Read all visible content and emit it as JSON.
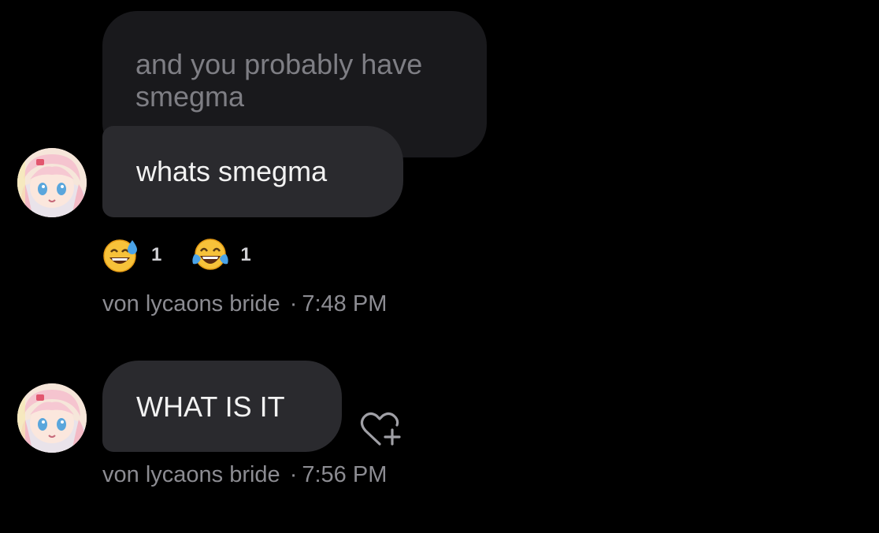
{
  "conversation": {
    "quoted_message": {
      "text": "and you probably have smegma"
    },
    "messages": [
      {
        "text": "whats smegma",
        "reactions": [
          {
            "emoji": "sweat-smile-emoji",
            "count": "1"
          },
          {
            "emoji": "tears-of-joy-emoji",
            "count": "1"
          }
        ],
        "sender": "von lycaons bride",
        "separator": "·",
        "time": "7:48 PM"
      },
      {
        "text": "WHAT IS IT",
        "sender": "von lycaons bride",
        "separator": "·",
        "time": "7:56 PM",
        "action_icon": "heart-plus-icon"
      }
    ]
  },
  "colors": {
    "background": "#000000",
    "incoming_bubble": "#2a2a2e",
    "quoted_bubble": "#19191c",
    "meta_text": "#8c8c92"
  }
}
